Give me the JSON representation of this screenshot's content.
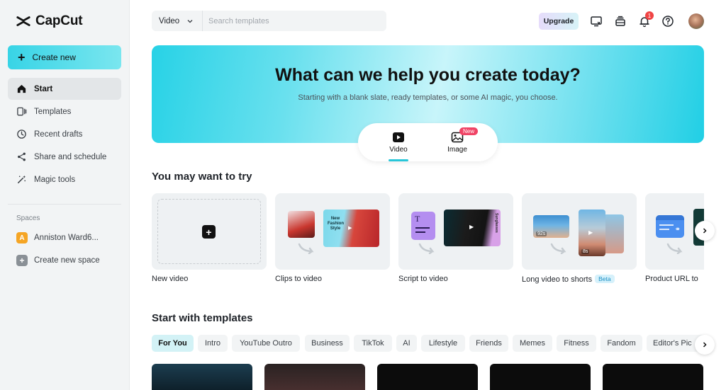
{
  "sidebar": {
    "logo_text": "CapCut",
    "create_label": "Create new",
    "nav": [
      {
        "label": "Start",
        "icon": "home-icon",
        "active": true
      },
      {
        "label": "Templates",
        "icon": "templates-icon"
      },
      {
        "label": "Recent drafts",
        "icon": "clock-icon"
      },
      {
        "label": "Share and schedule",
        "icon": "share-icon"
      },
      {
        "label": "Magic tools",
        "icon": "magic-wand-icon"
      }
    ],
    "spaces_label": "Spaces",
    "spaces": [
      {
        "badge": "A",
        "label": "Anniston Ward6..."
      },
      {
        "badge": "+",
        "label": "Create new space"
      }
    ]
  },
  "topbar": {
    "search_type": "Video",
    "search_placeholder": "Search templates",
    "upgrade_label": "Upgrade",
    "notification_count": "1",
    "icons": [
      "device-icon",
      "inbox-icon",
      "bell-icon",
      "help-icon"
    ]
  },
  "hero": {
    "title": "What can we help you create today?",
    "subtitle": "Starting with a blank slate, ready templates, or some AI magic, you choose.",
    "tabs": [
      {
        "label": "Video",
        "icon": "video-play-icon",
        "active": true
      },
      {
        "label": "Image",
        "icon": "image-icon",
        "badge": "New"
      }
    ]
  },
  "try_section": {
    "title": "You may want to try",
    "cards": [
      {
        "label": "New video"
      },
      {
        "label": "Clips to video",
        "thumb_text": "New Fashion Style"
      },
      {
        "label": "Script to video",
        "thumb_text": "Sunglasses"
      },
      {
        "label": "Long video to shorts",
        "badge": "Beta",
        "durations": [
          "92s",
          "8s"
        ]
      },
      {
        "label": "Product URL to"
      }
    ]
  },
  "templates_section": {
    "title": "Start with templates",
    "chips": [
      "For You",
      "Intro",
      "YouTube Outro",
      "Business",
      "TikTok",
      "AI",
      "Lifestyle",
      "Friends",
      "Memes",
      "Fitness",
      "Fandom",
      "Editor's Pic"
    ],
    "active_chip": "For You"
  },
  "colors": {
    "accent": "#27c6d9",
    "sidebar_bg": "#f2f4f5",
    "notification": "#f04444"
  }
}
